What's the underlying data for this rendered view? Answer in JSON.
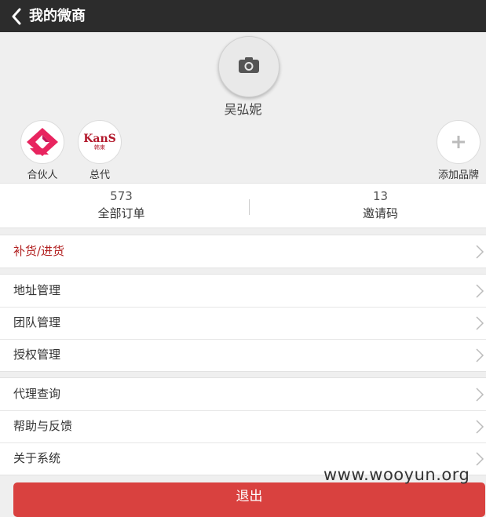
{
  "header": {
    "title": "我的微商",
    "back_icon": "chevron-left-icon"
  },
  "profile": {
    "avatar_icon": "camera-icon",
    "name": "吴弘妮"
  },
  "brands": [
    {
      "label": "合伙人",
      "logo": "partner-logo",
      "color": "#e8245f"
    },
    {
      "label": "总代",
      "logo_text": "KanS",
      "logo_subtext": "韩束",
      "color": "#b2182b"
    }
  ],
  "add_brand": {
    "label": "添加品牌",
    "icon": "plus-icon"
  },
  "stats": [
    {
      "value": "573",
      "label": "全部订单"
    },
    {
      "value": "13",
      "label": "邀请码"
    }
  ],
  "menu": {
    "restock": "补货/进货",
    "address": "地址管理",
    "team": "团队管理",
    "authorization": "授权管理",
    "agent_query": "代理查询",
    "help": "帮助与反馈",
    "about": "关于系统"
  },
  "logout_label": "退出",
  "watermark": "www.wooyun.org",
  "colors": {
    "topbar": "#2c2c2c",
    "accent_red": "#b22222",
    "logout": "#d9413f"
  }
}
